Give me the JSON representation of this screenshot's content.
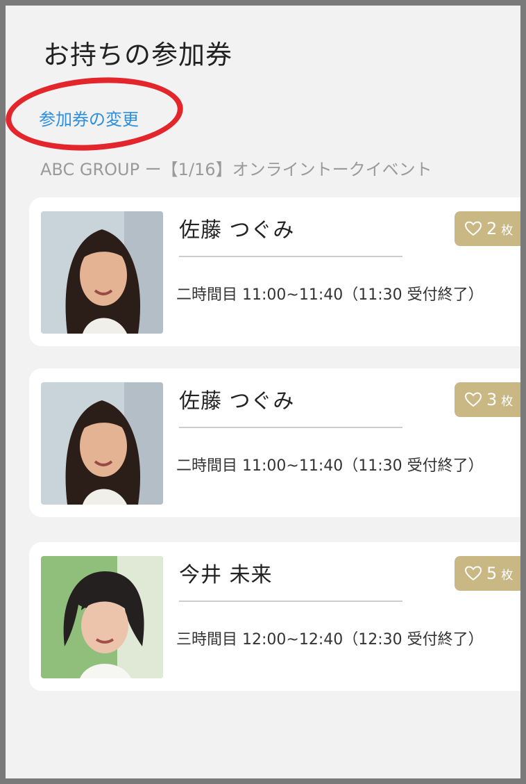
{
  "page": {
    "title": "お持ちの参加券",
    "change_link": "参加券の変更",
    "event_heading": "ABC GROUP ー【1/16】オンライントークイベント"
  },
  "tickets": [
    {
      "name": "佐藤 つぐみ",
      "slot": "二時間目 11:00~11:40（11:30 受付終了）",
      "count": "2",
      "unit": "枚"
    },
    {
      "name": "佐藤 つぐみ",
      "slot": "二時間目 11:00~11:40（11:30 受付終了）",
      "count": "3",
      "unit": "枚"
    },
    {
      "name": "今井 未来",
      "slot": "三時間目 12:00~12:40（12:30 受付終了）",
      "count": "5",
      "unit": "枚"
    }
  ],
  "colors": {
    "link": "#2e8fdc",
    "badge": "#c9b884",
    "annotation": "#e3262b"
  },
  "icons": {
    "badge": "heart-outline-icon"
  }
}
